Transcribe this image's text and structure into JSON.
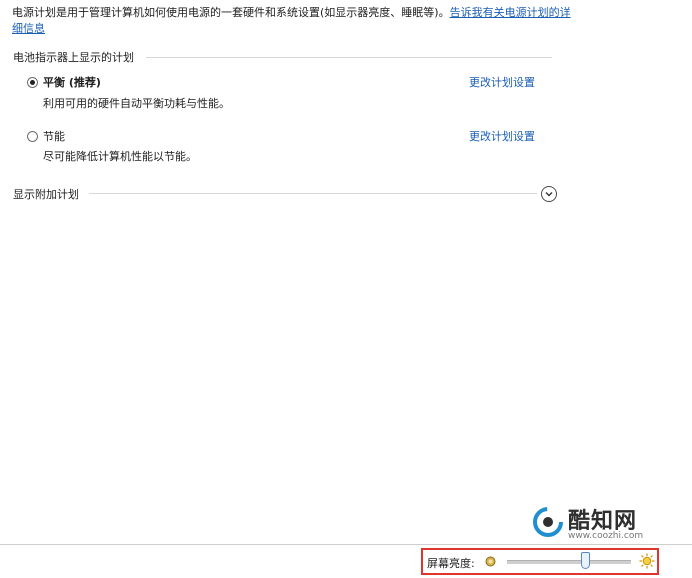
{
  "intro": {
    "text": "电源计划是用于管理计算机如何使用电源的一套硬件和系统设置(如显示器亮度、睡眠等)。",
    "link": "告诉我有关电源计划的详细信息"
  },
  "battery_section": {
    "title": "电池指示器上显示的计划",
    "plans": [
      {
        "name": "平衡 (推荐)",
        "description": "利用可用的硬件自动平衡功耗与性能。",
        "selected": true,
        "change_link": "更改计划设置"
      },
      {
        "name": "节能",
        "description": "尽可能降低计算机性能以节能。",
        "selected": false,
        "change_link": "更改计划设置"
      }
    ]
  },
  "additional_section": {
    "title": "显示附加计划"
  },
  "brightness": {
    "label": "屏幕亮度:",
    "level_percent": 63
  },
  "watermark": {
    "name": "酷知网",
    "url": "www.coozhi.com"
  },
  "colors": {
    "link": "#1a5fb4",
    "highlight_border": "#e0342e",
    "watermark_accent": "#1f8fd1"
  },
  "icons": [
    "radio-selected",
    "radio-unselected",
    "chevron-down-circle-icon",
    "dim-sun-icon",
    "bright-sun-icon",
    "coozhi-logo-icon"
  ]
}
